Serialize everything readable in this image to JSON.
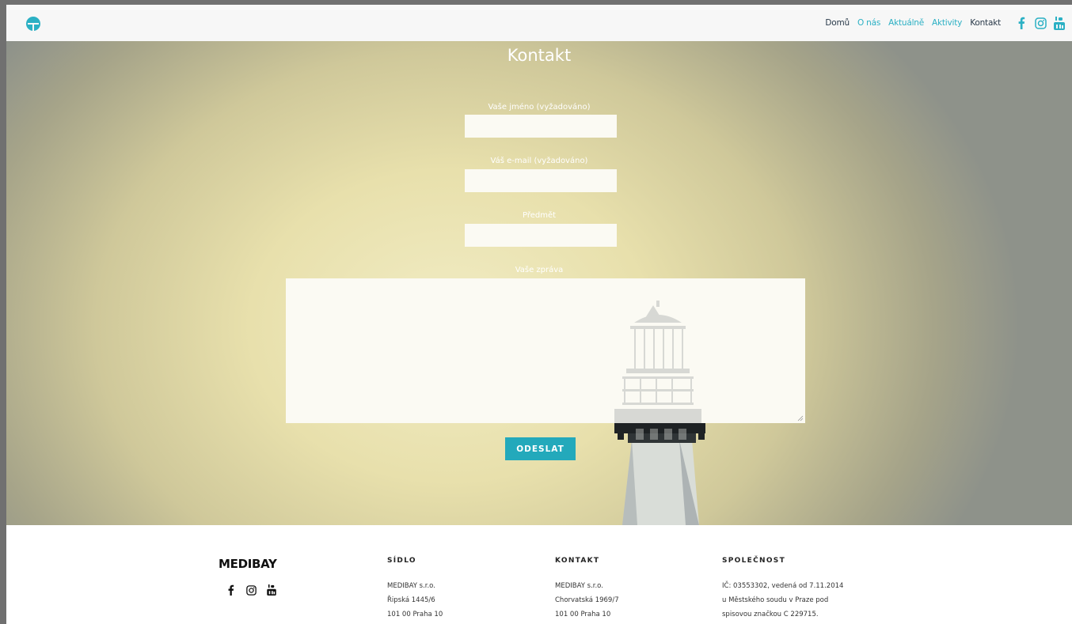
{
  "nav": {
    "items": [
      {
        "label": "Domů",
        "tone": "dark"
      },
      {
        "label": "O nás",
        "tone": "teal"
      },
      {
        "label": "Aktuálně",
        "tone": "teal"
      },
      {
        "label": "Aktivity",
        "tone": "teal"
      },
      {
        "label": "Kontakt",
        "tone": "dark"
      }
    ],
    "social_icons": [
      "facebook-icon",
      "instagram-icon",
      "youtube-icon"
    ]
  },
  "hero": {
    "title": "Kontakt",
    "form": {
      "name_label": "Vaše jméno (vyžadováno)",
      "name_value": "",
      "email_label": "Váš e-mail (vyžadováno)",
      "email_value": "",
      "subject_label": "Předmět",
      "subject_value": "",
      "message_label": "Vaše zpráva",
      "message_value": "",
      "submit_label": "ODESLAT"
    }
  },
  "footer": {
    "brand": "MEDIBAY",
    "social_icons": [
      "facebook-icon",
      "instagram-icon",
      "youtube-icon"
    ],
    "sidlo": {
      "heading": "SÍDLO",
      "lines": [
        "MEDIBAY s.r.o.",
        "Řipská 1445/6",
        "101 00 Praha 10"
      ]
    },
    "kontakt": {
      "heading": "KONTAKT",
      "lines": [
        "MEDIBAY s.r.o.",
        "Chorvatská 1969/7",
        "101 00 Praha 10"
      ]
    },
    "spolecnost": {
      "heading": "SPOLEČNOST",
      "lines": [
        "IČ: 03553302, vedená od 7.11.2014",
        "u Městského soudu v Praze pod",
        "spisovou značkou C 229715."
      ]
    }
  },
  "colors": {
    "accent": "#23a9bb",
    "nav_dark": "#2a3a4a",
    "nav_teal": "#2bb0c4",
    "hero_light": "#f1ecc4"
  }
}
